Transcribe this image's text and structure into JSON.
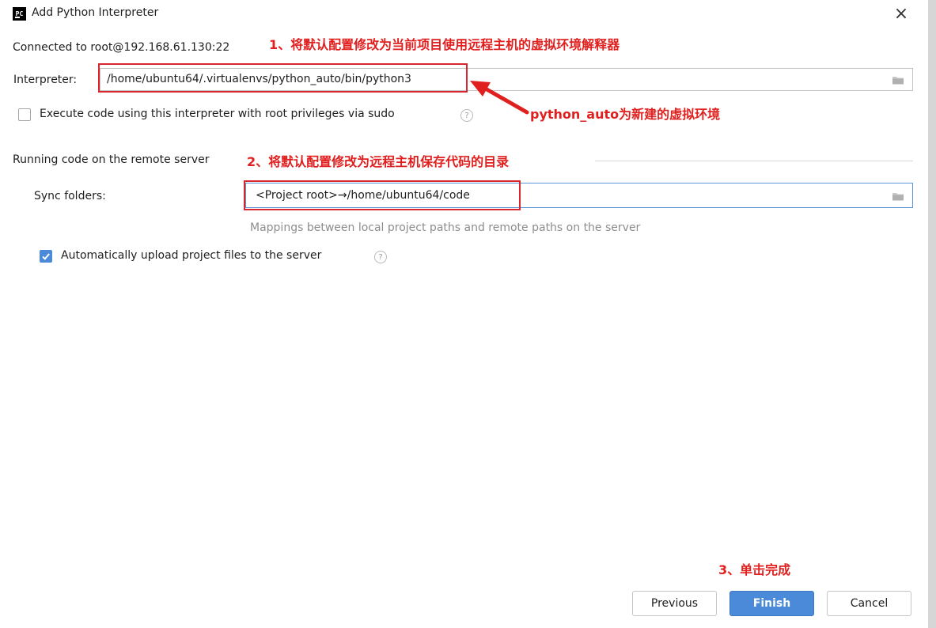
{
  "window": {
    "title": "Add Python Interpreter",
    "logo_text": "PC"
  },
  "connection": {
    "text": "Connected to root@192.168.61.130:22"
  },
  "interpreter": {
    "label": "Interpreter:",
    "value": "/home/ubuntu64/.virtualenvs/python_auto/bin/python3"
  },
  "sudo": {
    "label": "Execute code using this interpreter with root privileges via sudo",
    "checked": false
  },
  "remote": {
    "section_title": "Running code on the remote server",
    "sync_label": "Sync folders:",
    "sync_value": "<Project root>→/home/ubuntu64/code",
    "sync_hint": "Mappings between local project paths and remote paths on the server",
    "auto_upload_label": "Automatically upload project files to the server",
    "auto_upload_checked": true
  },
  "annotations": {
    "note1": "1、将默认配置修改为当前项目使用远程主机的虚拟环境解释器",
    "note_venv": "python_auto为新建的虚拟环境",
    "note2": "2、将默认配置修改为远程主机保存代码的目录",
    "note3": "3、单击完成",
    "color": "#e0201f"
  },
  "buttons": {
    "previous": "Previous",
    "finish": "Finish",
    "cancel": "Cancel"
  },
  "icons": {
    "help": "?",
    "close": "×"
  },
  "colors": {
    "accent": "#4a8ad8",
    "highlight_box": "#d9262e"
  }
}
